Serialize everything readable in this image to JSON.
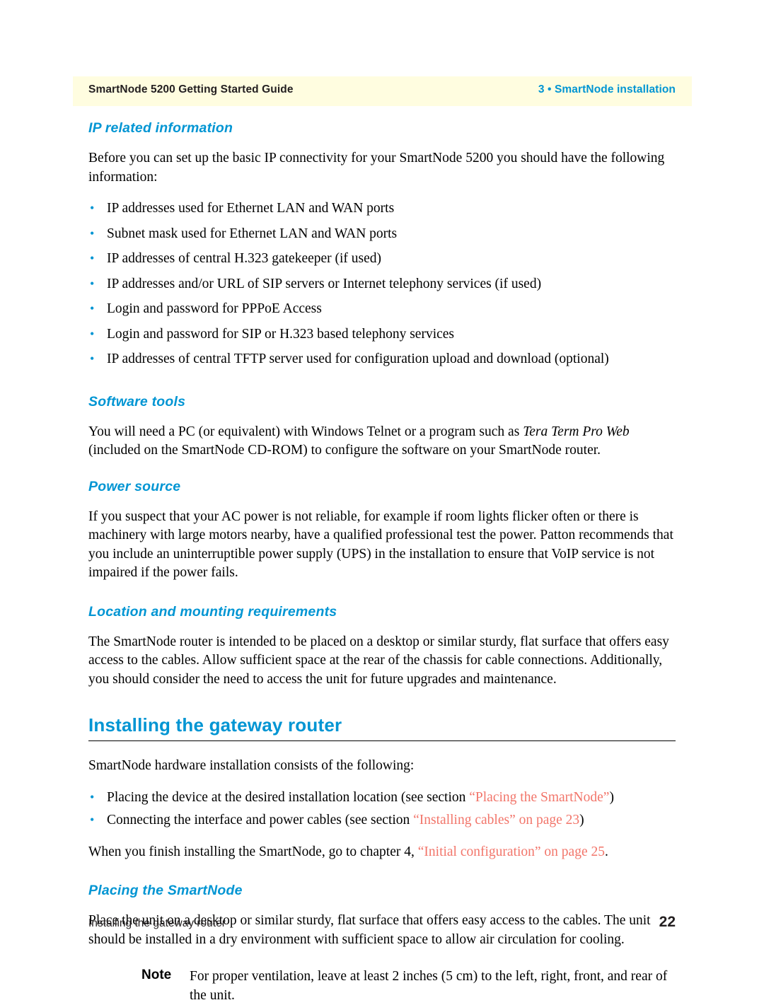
{
  "header": {
    "left": "SmartNode 5200 Getting Started Guide",
    "right": "3 • SmartNode installation",
    "band_color": "#fffde0",
    "accent_color": "#0095d3"
  },
  "sections": {
    "ip_related": {
      "heading": "IP related information",
      "intro": "Before you can set up the basic IP connectivity for your SmartNode 5200 you should have the following information:",
      "bullets": [
        "IP addresses used for Ethernet LAN and WAN ports",
        "Subnet mask used for Ethernet LAN and WAN ports",
        "IP addresses of central H.323 gatekeeper (if used)",
        "IP addresses and/or URL of SIP servers or Internet telephony services (if used)",
        "Login and password for PPPoE Access",
        "Login and password for SIP or H.323 based telephony services",
        "IP addresses of central TFTP server used for configuration upload and download (optional)"
      ]
    },
    "software_tools": {
      "heading": "Software tools",
      "text_part1": "You will need a PC (or equivalent) with Windows Telnet or a program such as ",
      "text_italic": "Tera Term Pro Web",
      "text_part2": " (included on the SmartNode CD-ROM) to configure the software on your SmartNode router."
    },
    "power_source": {
      "heading": "Power source",
      "text": "If you suspect that your AC power is not reliable, for example if room lights flicker often or there is machinery with large motors nearby, have a qualified professional test the power. Patton recommends that you include an uninterruptible power supply (UPS) in the installation to ensure that VoIP service is not impaired if the power fails."
    },
    "location_mounting": {
      "heading": "Location and mounting requirements",
      "text": "The SmartNode router is intended to be placed on a desktop or similar sturdy, flat surface that offers easy access to the cables. Allow sufficient space at the rear of the chassis for cable connections. Additionally, you should consider the need to access the unit for future upgrades and maintenance."
    },
    "installing_gateway": {
      "heading": "Installing the gateway router",
      "intro": "SmartNode hardware installation consists of the following:",
      "bullet1_pre": "Placing the device at the desired installation location (see section ",
      "bullet1_link": "“Placing the SmartNode”",
      "bullet1_post": ")",
      "bullet2_pre": "Connecting the interface and power cables (see section ",
      "bullet2_link": "“Installing cables” on page 23",
      "bullet2_post": ")",
      "closing_pre": "When you finish installing the SmartNode, go to chapter 4, ",
      "closing_link": "“Initial configuration” on page 25",
      "closing_post": "."
    },
    "placing_smartnode": {
      "heading": "Placing the SmartNode",
      "text": "Place the unit on a desktop or similar sturdy, flat surface that offers easy access to the cables. The unit should be installed in a dry environment with sufficient space to allow air circulation for cooling.",
      "note_label": "Note",
      "note_text": "For proper ventilation, leave at least 2 inches (5 cm) to the left, right, front, and rear of the unit."
    }
  },
  "footer": {
    "left": "Installing the gateway router",
    "page_number": "22"
  }
}
